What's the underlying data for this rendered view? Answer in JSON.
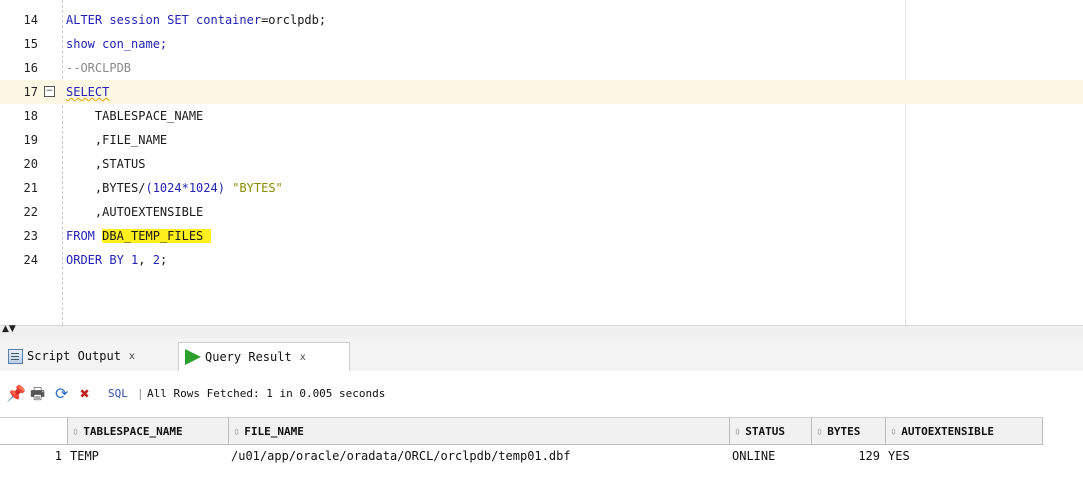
{
  "editor": {
    "lines": [
      {
        "n": "14",
        "tokens": [
          {
            "t": "ALTER session SET container",
            "c": "kw"
          },
          {
            "t": "=orclpdb;",
            "c": ""
          }
        ]
      },
      {
        "n": "15",
        "tokens": [
          {
            "t": "show con_name;",
            "c": "kw"
          }
        ]
      },
      {
        "n": "16",
        "tokens": [
          {
            "t": "--ORCLPDB",
            "c": "cm"
          }
        ]
      },
      {
        "n": "17",
        "tokens": [
          {
            "t": "SELECT",
            "c": "kw squig"
          }
        ]
      },
      {
        "n": "18",
        "tokens": [
          {
            "t": "    TABLESPACE_NAME",
            "c": ""
          }
        ]
      },
      {
        "n": "19",
        "tokens": [
          {
            "t": "    ,FILE_NAME",
            "c": ""
          }
        ]
      },
      {
        "n": "20",
        "tokens": [
          {
            "t": "    ,STATUS",
            "c": ""
          }
        ]
      },
      {
        "n": "21",
        "tokens": [
          {
            "t": "    ,BYTES/",
            "c": ""
          },
          {
            "t": "(1024*1024)",
            "c": "num"
          },
          {
            "t": " ",
            "c": ""
          },
          {
            "t": "\"BYTES\"",
            "c": "str"
          }
        ]
      },
      {
        "n": "22",
        "tokens": [
          {
            "t": "    ,AUTOEXTENSIBLE",
            "c": ""
          }
        ]
      },
      {
        "n": "23",
        "tokens": [
          {
            "t": "FROM ",
            "c": "kw"
          },
          {
            "t": "DBA_TEMP_FILES ",
            "c": "hl"
          }
        ]
      },
      {
        "n": "24",
        "tokens": [
          {
            "t": "ORDER BY ",
            "c": "kw"
          },
          {
            "t": "1",
            "c": "num"
          },
          {
            "t": ", ",
            "c": ""
          },
          {
            "t": "2",
            "c": "num"
          },
          {
            "t": ";",
            "c": ""
          }
        ]
      }
    ],
    "current_line": "17",
    "fold_marker": "−"
  },
  "tabs": {
    "script_output": {
      "label": "Script Output",
      "close": "x"
    },
    "query_result": {
      "label": "Query Result",
      "close": "x"
    }
  },
  "toolbar": {
    "pin_icon": "pin-icon",
    "print_icon": "print-icon",
    "refresh_icon": "refresh-icon",
    "delete_icon": "delete-icon",
    "sql_label": "SQL",
    "separator": "|",
    "status": "All Rows Fetched: 1 in 0.005 seconds"
  },
  "grid": {
    "columns": [
      "TABLESPACE_NAME",
      "FILE_NAME",
      "STATUS",
      "BYTES",
      "AUTOEXTENSIBLE"
    ],
    "sort_glyph": "⇳",
    "rows": [
      {
        "num": "1",
        "TABLESPACE_NAME": "TEMP",
        "FILE_NAME": "/u01/app/oracle/oradata/ORCL/orclpdb/temp01.dbf",
        "STATUS": "ONLINE",
        "BYTES": "129",
        "AUTOEXTENSIBLE": "YES"
      }
    ]
  },
  "colors": {
    "keyword": "#2323b6",
    "comment": "#8a8a8a",
    "string": "#8c8c00",
    "highlight": "#ffef1c",
    "run_icon": "#2ca02c"
  }
}
